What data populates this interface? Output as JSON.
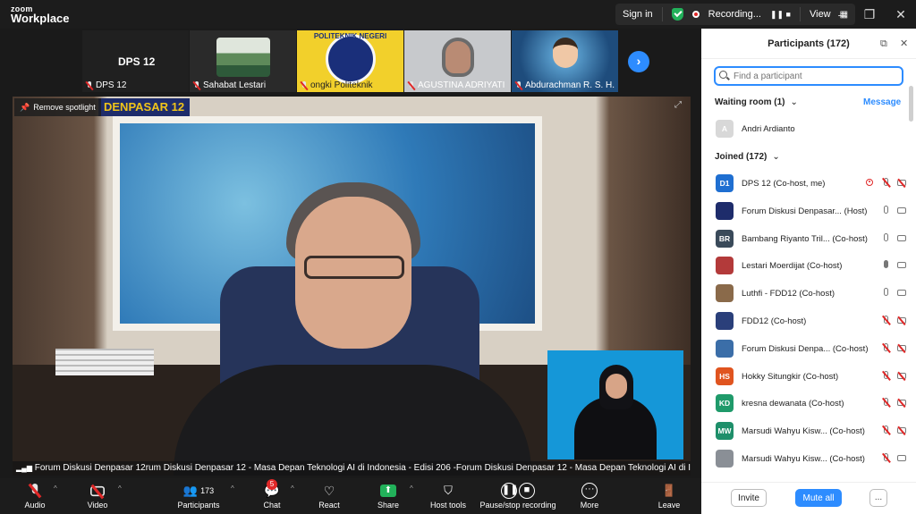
{
  "app": {
    "logo_line1": "zoom",
    "logo_line2": "Workplace"
  },
  "topbar": {
    "sign_in": "Sign in",
    "recording": "Recording...",
    "view": "View"
  },
  "thumbnails": [
    {
      "name": "DPS 12",
      "overlay": "DPS 12",
      "bg": "#202020"
    },
    {
      "name": "Sahabat Lestari",
      "bg": "#2a2a2a"
    },
    {
      "name": "ongki Politeknik",
      "overlay": "POLITEKNIK NEGERI",
      "bg": "#f2d02b"
    },
    {
      "name": "AGUSTINA ADRIYATI",
      "bg": "#c7c9cc"
    },
    {
      "name": "Abdurachman R. S. H.",
      "bg": "#1e4c7c"
    }
  ],
  "main_video": {
    "spotlight_label": "Remove spotlight",
    "banner": "DENPASAR 12",
    "ticker": "Forum Diskusi Denpasar 12rum Diskusi Denpasar 12 - Masa Depan Teknologi AI di Indonesia - Edisi 206 -Forum Diskusi Denpasar 12 - Masa Depan Teknologi AI di Indonesia"
  },
  "toolbar": {
    "audio": "Audio",
    "video": "Video",
    "participants": "Participants",
    "participants_count": "173",
    "chat": "Chat",
    "chat_badge": "5",
    "react": "React",
    "share": "Share",
    "host_tools": "Host tools",
    "pause_recording": "Pause/stop recording",
    "more": "More",
    "leave": "Leave"
  },
  "panel": {
    "title": "Participants (172)",
    "search_placeholder": "Find a participant",
    "waiting_room": "Waiting room (1)",
    "message": "Message",
    "waiting": [
      {
        "initials": "A",
        "name": "Andri Ardianto",
        "color": "#d8d8d8"
      }
    ],
    "joined_header": "Joined (172)",
    "joined": [
      {
        "initials": "D1",
        "name": "DPS 12 (Co-host, me)",
        "color": "#1f6fd1",
        "mic": "off",
        "video": "off",
        "rec": true
      },
      {
        "initials": "",
        "name": "Forum Diskusi Denpasar... (Host)",
        "color": "#1e2c6b",
        "mic": "on",
        "video": "on"
      },
      {
        "initials": "BR",
        "name": "Bambang Riyanto Tril... (Co-host)",
        "color": "#3a4a5a",
        "mic": "on",
        "video": "on"
      },
      {
        "initials": "",
        "name": "Lestari Moerdijat (Co-host)",
        "color": "#b33a3a",
        "mic": "active",
        "video": "on"
      },
      {
        "initials": "",
        "name": "Luthfi - FDD12 (Co-host)",
        "color": "#8a6a4a",
        "mic": "on",
        "video": "on"
      },
      {
        "initials": "",
        "name": "FDD12 (Co-host)",
        "color": "#2a3f7a",
        "mic": "off",
        "video": "off"
      },
      {
        "initials": "",
        "name": "Forum Diskusi Denpa... (Co-host)",
        "color": "#3b6ea8",
        "mic": "off",
        "video": "off"
      },
      {
        "initials": "HS",
        "name": "Hokky Situngkir (Co-host)",
        "color": "#e0541f",
        "mic": "off",
        "video": "off"
      },
      {
        "initials": "KD",
        "name": "kresna dewanata (Co-host)",
        "color": "#1f9a6a",
        "mic": "off",
        "video": "off"
      },
      {
        "initials": "MW",
        "name": "Marsudi Wahyu Kisw... (Co-host)",
        "color": "#1e8f6a",
        "mic": "off",
        "video": "off"
      },
      {
        "initials": "",
        "name": "Marsudi Wahyu Kisw... (Co-host)",
        "color": "#8a8f96",
        "mic": "off",
        "video": "on"
      }
    ],
    "invite": "Invite",
    "mute_all": "Mute all",
    "more": "..."
  }
}
